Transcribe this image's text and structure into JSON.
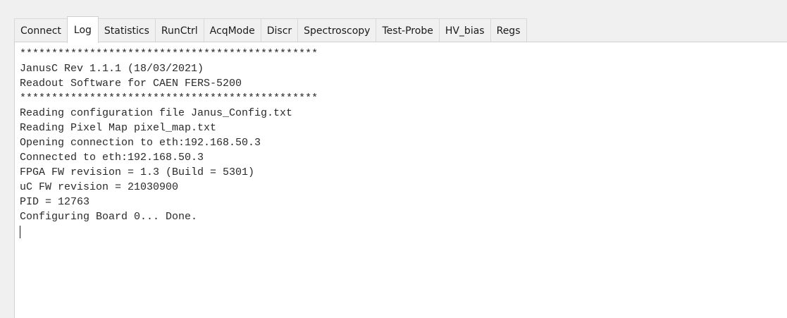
{
  "tabs": [
    {
      "label": "Connect",
      "active": false
    },
    {
      "label": "Log",
      "active": true
    },
    {
      "label": "Statistics",
      "active": false
    },
    {
      "label": "RunCtrl",
      "active": false
    },
    {
      "label": "AcqMode",
      "active": false
    },
    {
      "label": "Discr",
      "active": false
    },
    {
      "label": "Spectroscopy",
      "active": false
    },
    {
      "label": "Test-Probe",
      "active": false
    },
    {
      "label": "HV_bias",
      "active": false
    },
    {
      "label": "Regs",
      "active": false
    }
  ],
  "log": {
    "lines": [
      "***********************************************",
      "JanusC Rev 1.1.1 (18/03/2021)",
      "Readout Software for CAEN FERS-5200",
      "***********************************************",
      "Reading configuration file Janus_Config.txt",
      "Reading Pixel Map pixel_map.txt",
      "Opening connection to eth:192.168.50.3",
      "Connected to eth:192.168.50.3",
      "FPGA FW revision = 1.3 (Build = 5301)",
      "uC FW revision = 21030900",
      "PID = 12763",
      "Configuring Board 0... Done."
    ]
  }
}
